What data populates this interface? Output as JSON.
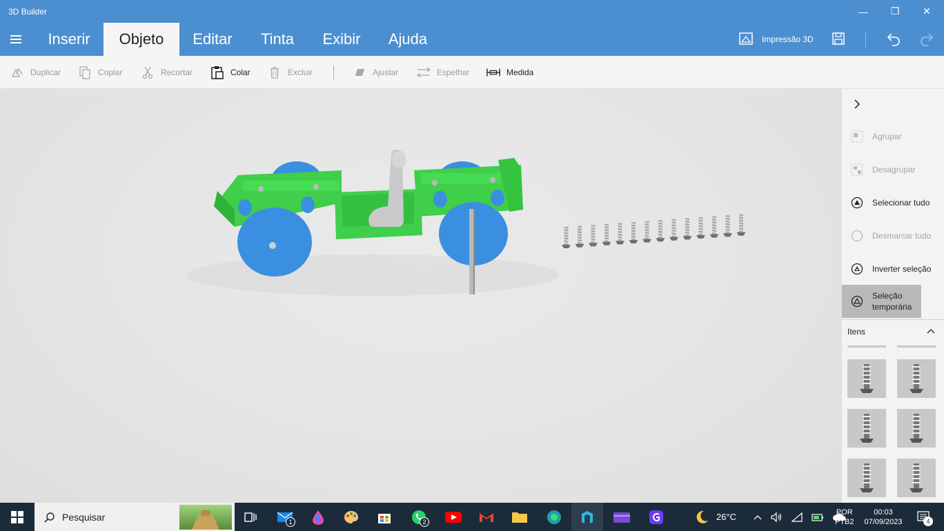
{
  "window": {
    "title": "3D Builder",
    "minimize_glyph": "—",
    "maximize_glyph": "❐",
    "close_glyph": "✕"
  },
  "ribbon": {
    "tabs": [
      {
        "label": "Inserir"
      },
      {
        "label": "Objeto"
      },
      {
        "label": "Editar"
      },
      {
        "label": "Tinta"
      },
      {
        "label": "Exibir"
      },
      {
        "label": "Ajuda"
      }
    ],
    "active_tab": "Objeto",
    "print3d_label": "Impressão 3D"
  },
  "toolbar": {
    "duplicate": "Duplicar",
    "copy": "Copiar",
    "cut": "Recortar",
    "paste": "Colar",
    "delete": "Excluir",
    "adjust": "Ajustar",
    "mirror": "Espelhar",
    "measure": "Medida"
  },
  "panel": {
    "group": "Agrupar",
    "ungroup": "Desagrupar",
    "select_all": "Selecionar tudo",
    "deselect_all": "Desmarcar tudo",
    "invert_selection": "Inverter seleção",
    "temp_selection_line1": "Seleção",
    "temp_selection_line2": "temporária",
    "items_title": "Itens"
  },
  "taskbar": {
    "search_placeholder": "Pesquisar",
    "mail_badge": "1",
    "whatsapp_badge": "2",
    "weather": "26°C",
    "lang_line1": "POR",
    "lang_line2": "PTB2",
    "time": "00:03",
    "date": "07/09/2023",
    "notification_count": "4"
  },
  "colors": {
    "accent": "#4c8fd0",
    "model_green": "#3fcf4a",
    "model_blue": "#3a8fe0",
    "model_gray": "#c9c9c9",
    "taskbar": "#1c2b3a"
  }
}
